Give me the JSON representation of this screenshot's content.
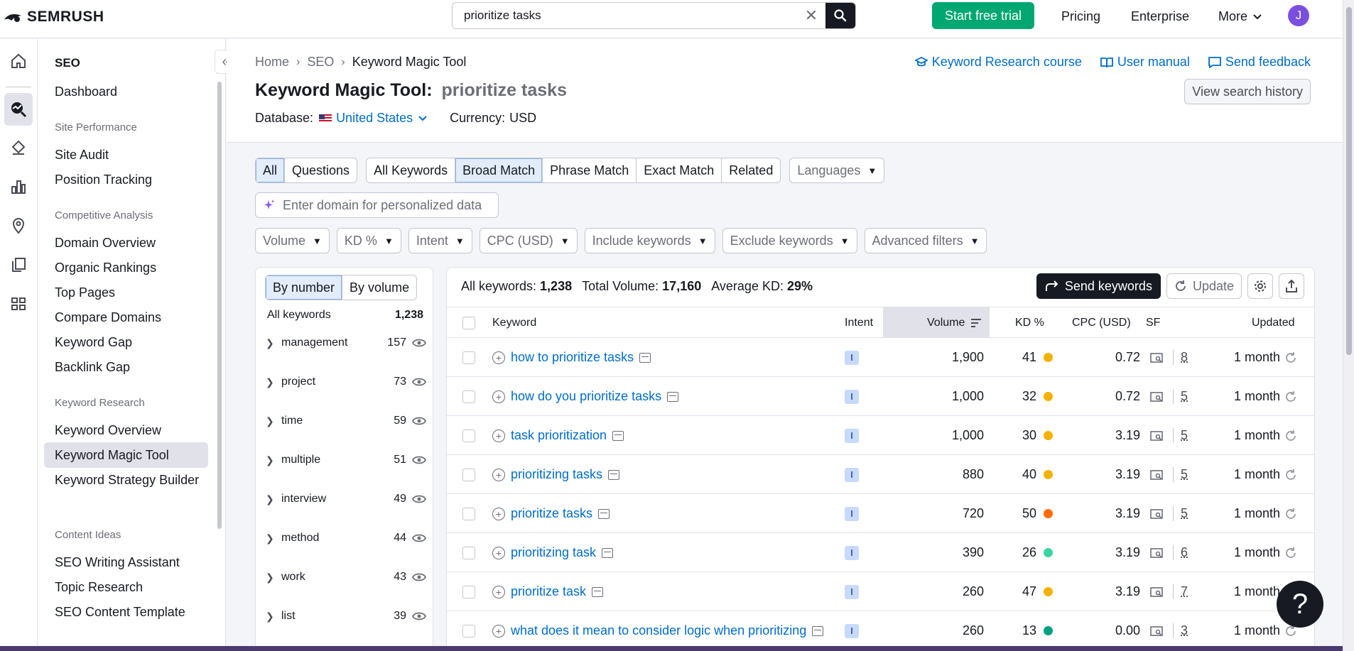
{
  "brand": "SEMRUSH",
  "search": {
    "value": "prioritize tasks"
  },
  "topnav": {
    "trial": "Start free trial",
    "pricing": "Pricing",
    "enterprise": "Enterprise",
    "more": "More",
    "avatar": "J"
  },
  "sidebar": {
    "title": "SEO",
    "dashboard": "Dashboard",
    "sections": [
      {
        "label": "Site Performance",
        "items": [
          "Site Audit",
          "Position Tracking"
        ]
      },
      {
        "label": "Competitive Analysis",
        "items": [
          "Domain Overview",
          "Organic Rankings",
          "Top Pages",
          "Compare Domains",
          "Keyword Gap",
          "Backlink Gap"
        ]
      },
      {
        "label": "Keyword Research",
        "items": [
          "Keyword Overview",
          "Keyword Magic Tool",
          "Keyword Strategy Builder"
        ]
      },
      {
        "label": "Content Ideas",
        "items": [
          "SEO Writing Assistant",
          "Topic Research",
          "SEO Content Template"
        ]
      }
    ]
  },
  "breadcrumb": {
    "home": "Home",
    "seo": "SEO",
    "current": "Keyword Magic Tool"
  },
  "header": {
    "title": "Keyword Magic Tool:",
    "query": "prioritize tasks",
    "db_label": "Database:",
    "db_value": "United States",
    "currency_label": "Currency:",
    "currency_value": "USD",
    "links": {
      "course": "Keyword Research course",
      "manual": "User manual",
      "feedback": "Send feedback"
    },
    "history": "View search history"
  },
  "tabs": {
    "all": "All",
    "questions": "Questions",
    "all_keywords": "All Keywords",
    "broad": "Broad Match",
    "phrase": "Phrase Match",
    "exact": "Exact Match",
    "related": "Related",
    "languages": "Languages"
  },
  "domain_placeholder": "Enter domain for personalized data",
  "filters": {
    "volume": "Volume",
    "kd": "KD %",
    "intent": "Intent",
    "cpc": "CPC (USD)",
    "include": "Include keywords",
    "exclude": "Exclude keywords",
    "advanced": "Advanced filters"
  },
  "groups": {
    "by_number": "By number",
    "by_volume": "By volume",
    "all_label": "All keywords",
    "all_count": "1,238",
    "items": [
      {
        "name": "management",
        "count": "157"
      },
      {
        "name": "project",
        "count": "73"
      },
      {
        "name": "time",
        "count": "59"
      },
      {
        "name": "multiple",
        "count": "51"
      },
      {
        "name": "interview",
        "count": "49"
      },
      {
        "name": "method",
        "count": "44"
      },
      {
        "name": "work",
        "count": "43"
      },
      {
        "name": "list",
        "count": "39"
      }
    ]
  },
  "stats": {
    "all_label": "All keywords:",
    "all_value": "1,238",
    "vol_label": "Total Volume:",
    "vol_value": "17,160",
    "kd_label": "Average KD:",
    "kd_value": "29%"
  },
  "actions": {
    "send": "Send keywords",
    "update": "Update"
  },
  "columns": {
    "keyword": "Keyword",
    "intent": "Intent",
    "volume": "Volume",
    "kd": "KD %",
    "cpc": "CPC (USD)",
    "sf": "SF",
    "updated": "Updated"
  },
  "colors": {
    "kd_orange": "#f5b100",
    "kd_dark_orange": "#ff6b00",
    "kd_teal": "#3ad6a0",
    "kd_green": "#009f81"
  },
  "rows": [
    {
      "keyword": "how to prioritize tasks",
      "intent": "I",
      "volume": "1,900",
      "kd": "41",
      "kd_color": "#f5b100",
      "cpc": "0.72",
      "sf": "8",
      "updated": "1 month"
    },
    {
      "keyword": "how do you prioritize tasks",
      "intent": "I",
      "volume": "1,000",
      "kd": "32",
      "kd_color": "#f5b100",
      "cpc": "0.72",
      "sf": "5",
      "updated": "1 month"
    },
    {
      "keyword": "task prioritization",
      "intent": "I",
      "volume": "1,000",
      "kd": "30",
      "kd_color": "#f5b100",
      "cpc": "3.19",
      "sf": "5",
      "updated": "1 month"
    },
    {
      "keyword": "prioritizing tasks",
      "intent": "I",
      "volume": "880",
      "kd": "40",
      "kd_color": "#f5b100",
      "cpc": "3.19",
      "sf": "5",
      "updated": "1 month"
    },
    {
      "keyword": "prioritize tasks",
      "intent": "I",
      "volume": "720",
      "kd": "50",
      "kd_color": "#ff6b00",
      "cpc": "3.19",
      "sf": "5",
      "updated": "1 month"
    },
    {
      "keyword": "prioritizing task",
      "intent": "I",
      "volume": "390",
      "kd": "26",
      "kd_color": "#3ad6a0",
      "cpc": "3.19",
      "sf": "6",
      "updated": "1 month"
    },
    {
      "keyword": "prioritize task",
      "intent": "I",
      "volume": "260",
      "kd": "47",
      "kd_color": "#f5b100",
      "cpc": "3.19",
      "sf": "7",
      "updated": "1 month"
    },
    {
      "keyword": "what does it mean to consider logic when prioritizing",
      "intent": "I",
      "volume": "260",
      "kd": "13",
      "kd_color": "#009f81",
      "cpc": "0.00",
      "sf": "3",
      "updated": "1 month"
    }
  ],
  "help": "?"
}
